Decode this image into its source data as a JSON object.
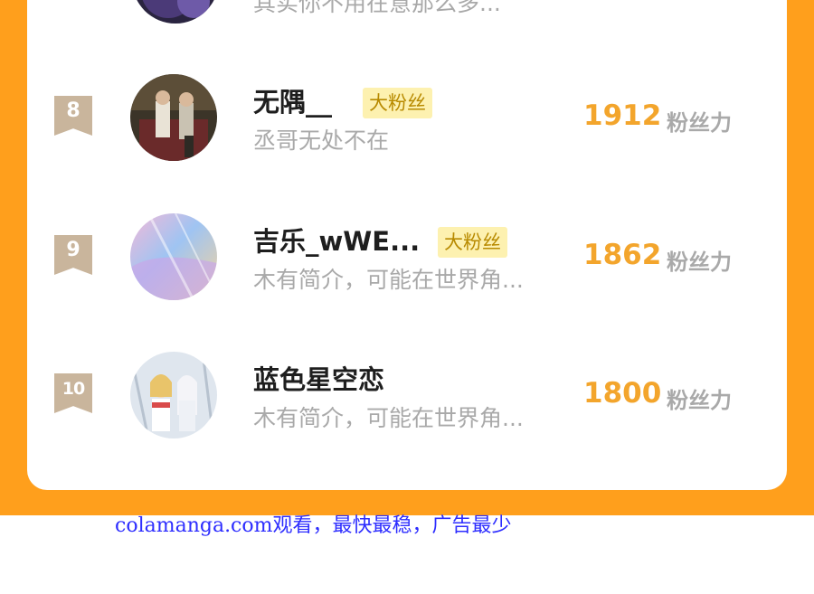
{
  "leaderboard": {
    "top_partial": {
      "bio": "其实你不用在意那么多..."
    },
    "entries": [
      {
        "rank": "8",
        "username": "无隅__",
        "badge": "大粉丝",
        "bio": "丞哥无处不在",
        "score": "1912",
        "score_unit": "粉丝力"
      },
      {
        "rank": "9",
        "username": "吉乐_wWE...",
        "badge": "大粉丝",
        "bio": "木有简介，可能在世界角...",
        "score": "1862",
        "score_unit": "粉丝力"
      },
      {
        "rank": "10",
        "username": "蓝色星空恋",
        "bio": "木有简介，可能在世界角...",
        "score": "1800",
        "score_unit": "粉丝力"
      }
    ]
  },
  "watermark": "colamanga.com观看，最快最稳，广告最少",
  "colors": {
    "page_accent": "#ff9f1c",
    "score": "#f3a52c",
    "rank_badge": "#c9b59c",
    "fan_badge_bg": "#fdf1b0",
    "fan_badge_text": "#b88a00",
    "watermark": "#2d2dff"
  }
}
